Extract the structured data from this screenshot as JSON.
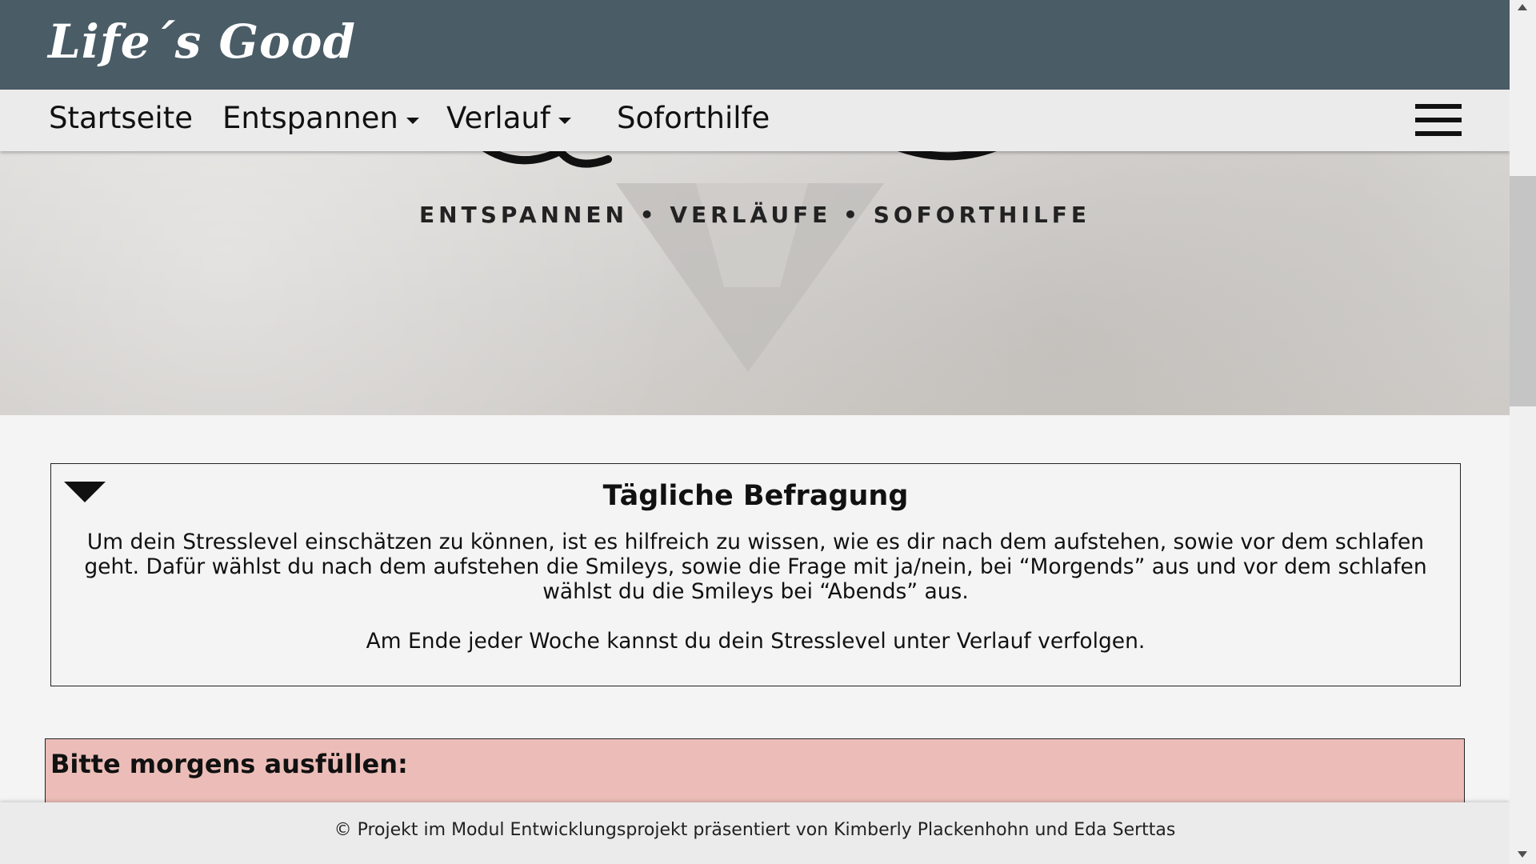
{
  "header": {
    "brand": "Life´s Good"
  },
  "nav": {
    "items": [
      {
        "label": "Startseite"
      },
      {
        "label": "Entspannen"
      },
      {
        "label": "Verlauf"
      },
      {
        "label": "Soforthilfe"
      }
    ]
  },
  "hero": {
    "tagline": "ENTSPANNEN • VERLÄUFE • SOFORTHILFE"
  },
  "survey": {
    "title": "Tägliche Befragung",
    "text": "Um dein Stresslevel einschätzen zu können, ist es hilfreich zu wissen, wie es dir nach dem aufstehen, sowie vor dem schlafen geht. Dafür wählst du nach dem aufstehen die Smileys, sowie die Frage mit ja/nein, bei “Morgends” aus und vor dem schlafen wählst du die Smileys bei “Abends” aus.",
    "text2": "Am Ende jeder Woche kannst du dein Stresslevel unter Verlauf verfolgen."
  },
  "morning": {
    "title": "Bitte morgens ausfüllen:"
  },
  "footer": {
    "text": "© Projekt im Modul Entwicklungsprojekt präsentiert von Kimberly Plackenhohn und Eda Serttas"
  },
  "colors": {
    "header_bg": "#4a5c66",
    "nav_bg": "#ebebeb",
    "morning_panel_bg": "#ecbdb8"
  },
  "icons": [
    "menu-icon",
    "caret-down-icon",
    "collapse-triangle-icon"
  ]
}
